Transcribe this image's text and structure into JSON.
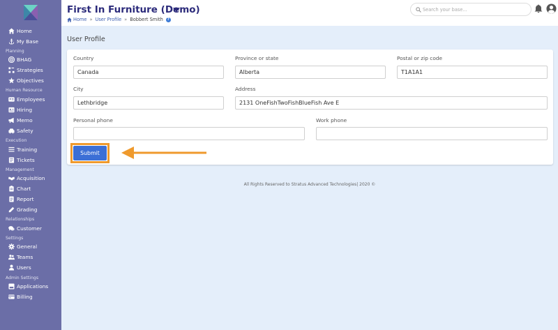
{
  "colors": {
    "sidebar_bg": "#6b6ea7",
    "brand": "#2c2b7b",
    "main_bg": "#e4eefa",
    "button": "#3b6fd6",
    "highlight": "#ef9a2d"
  },
  "header": {
    "company": "First In Furniture (Demo)",
    "search_placeholder": "Search your base...",
    "breadcrumb": {
      "home": "Home",
      "section": "User Profile",
      "current": "Bobbert Smith",
      "separator": "»"
    }
  },
  "sidebar": {
    "top": [
      {
        "label": "Home",
        "icon": "home-icon"
      },
      {
        "label": "My Base",
        "icon": "anchor-icon"
      }
    ],
    "sections": [
      {
        "title": "Planning",
        "items": [
          {
            "label": "BHAG",
            "icon": "bullseye-icon"
          },
          {
            "label": "Strategies",
            "icon": "strategy-icon"
          },
          {
            "label": "Objectives",
            "icon": "star-icon"
          }
        ]
      },
      {
        "title": "Human Resource",
        "items": [
          {
            "label": "Employees",
            "icon": "id-card-icon"
          },
          {
            "label": "Hiring",
            "icon": "id-badge-icon"
          },
          {
            "label": "Memo",
            "icon": "megaphone-icon"
          },
          {
            "label": "Safety",
            "icon": "car-icon"
          }
        ]
      },
      {
        "title": "Execution",
        "items": [
          {
            "label": "Training",
            "icon": "chalkboard-icon"
          },
          {
            "label": "Tickets",
            "icon": "ticket-icon"
          }
        ]
      },
      {
        "title": "Management",
        "items": [
          {
            "label": "Acquisition",
            "icon": "handshake-icon"
          },
          {
            "label": "Chart",
            "icon": "clipboard-icon"
          },
          {
            "label": "Report",
            "icon": "report-icon"
          },
          {
            "label": "Grading",
            "icon": "pencil-icon"
          }
        ]
      },
      {
        "title": "Relationships",
        "items": [
          {
            "label": "Customer",
            "icon": "comments-icon"
          }
        ]
      },
      {
        "title": "Settings",
        "items": [
          {
            "label": "General",
            "icon": "gear-icon"
          },
          {
            "label": "Teams",
            "icon": "users-icon"
          },
          {
            "label": "Users",
            "icon": "user-icon"
          }
        ]
      },
      {
        "title": "Admin Settings",
        "items": [
          {
            "label": "Applications",
            "icon": "apps-icon"
          },
          {
            "label": "Billing",
            "icon": "credit-card-icon"
          }
        ]
      }
    ]
  },
  "profile": {
    "title": "User Profile",
    "fields": {
      "country": {
        "label": "Country",
        "value": "Canada"
      },
      "province": {
        "label": "Province or state",
        "value": "Alberta"
      },
      "postal": {
        "label": "Postal or zip code",
        "value": "T1A1A1"
      },
      "city": {
        "label": "City",
        "value": "Lethbridge"
      },
      "address": {
        "label": "Address",
        "value": "2131 OneFishTwoFishBlueFish Ave E"
      },
      "personal_phone": {
        "label": "Personal phone",
        "value": ""
      },
      "work_phone": {
        "label": "Work phone",
        "value": ""
      }
    },
    "submit_label": "Submit"
  },
  "footer": {
    "text": "All Rights Reserved to Stratus Advanced Technologies| 2020 ©"
  }
}
